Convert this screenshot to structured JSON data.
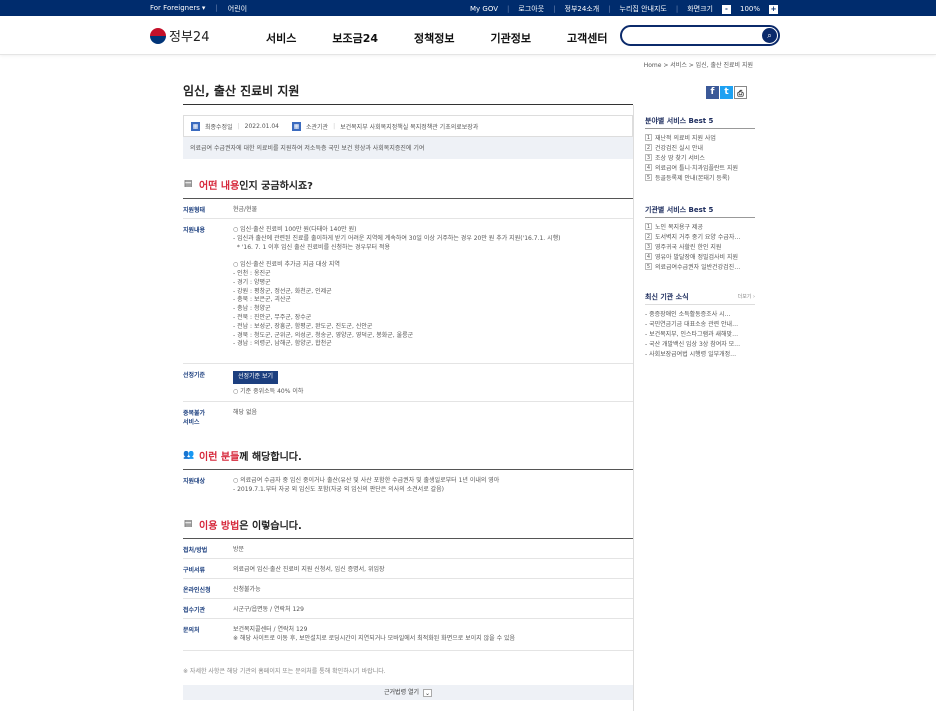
{
  "topbar": {
    "foreigners": "For Foreigners",
    "kids": "어린이",
    "mygov": "My GOV",
    "login": "로그아웃",
    "intro": "정부24소개",
    "sitemap": "누리집 안내지도",
    "screen": "화면크기",
    "zoom_out": "-",
    "zoom": "100%",
    "zoom_in": "+"
  },
  "header": {
    "logo": "정부24",
    "nav": [
      "서비스",
      "보조금24",
      "정책정보",
      "기관정보",
      "고객센터"
    ],
    "search_placeholder": "",
    "search_icon": "search-icon"
  },
  "breadcrumb": "Home  >  서비스  >  임신, 출산 진료비 지원",
  "page": {
    "title": "임신, 출산 진료비 지원",
    "share": {
      "facebook": "f",
      "twitter": "t",
      "print": "⎙"
    },
    "meta": {
      "date_label": "최종수정일",
      "date": "2022.01.04",
      "org_label": "소관기관",
      "org": "보건복지부 사회복지정책실 복지정책관 기초의료보장과"
    },
    "summary": "의료급여 수급권자에 대한 의료비를 지원하여 저소득층 국민 보건 향상과 사회복지증진에 기여",
    "sec1": {
      "hi": "어떤 내용",
      "rest": "인지 궁금하시죠?"
    },
    "form_label": "지원형태",
    "form_value": "현금/현물",
    "content_label": "지원내용",
    "content_value": "○ 임신·출산 진료비 100만 원(다태아 140만 원)\n- 임신과 출산에 관련된 진료를 출이하게 받기 어려운 지역에 계속하여 30일 이상 거주하는 경우 20만 원 추가 지원('16.7.1. 시행)\n  * '16. 7. 1 이후 임신 출산 진료비를 신청하는 경우부터 적용\n\n○ 임신·출산 진료비 추가금 지급 대상 지역\n- 인천 : 옹진군\n- 경기 : 양평군\n- 강원 : 평창군, 정선군, 화천군, 인제군\n- 충북 : 보은군, 괴산군\n- 충남 : 청양군\n- 전북 : 진안군, 무주군, 장수군\n- 전남 : 보성군, 장흥군, 함평군, 완도군, 진도군, 신안군\n- 경북 : 청도군, 군위군, 의성군, 청송군, 영양군, 영덕군, 봉화군, 울릉군\n- 경남 : 의령군, 남해군, 함양군, 합천군",
    "criteria_label": "선정기준",
    "criteria_button": "선정기준 보기",
    "criteria_value": "○ 기준 중위소득 40% 이하",
    "dup_label": "중복불가\n서비스",
    "dup_value": "해당 없음",
    "sec2": {
      "hi": "이런 분들",
      "rest": "께 해당합니다."
    },
    "target_label": "지원대상",
    "target_value": "○ 의료급여 수급자 중 임신 중이거나 출산(유산 및 사산 포함한 수급권자 및 출생일로부터 1년 이내의 영아\n- 2019.7.1.부터 자궁 외 임신도 포함(자궁 외 임신의 판단은 의사의 소견서로 갈음)",
    "sec3": {
      "hi": "이용 방법",
      "rest": "은 이렇습니다."
    },
    "method_label": "접처/방법",
    "method_value": "방문",
    "docs_label": "구비서류",
    "docs_value": "의료급여 임신·출산 진료비 지원 신청서, 임신 증명서, 위임장",
    "online_label": "온라인신청",
    "online_value": "신청불가능",
    "office_label": "접수기관",
    "office_value": "시군구/읍면동 / 연락처 129",
    "contact_label": "문의처",
    "contact_value": "보건복지콜센터 / 연락처 129\n※ 해당 사이트로 이동 후, 보안설치로 로딩시간이 지연되거나 모바일에서 최적화된 화면으로 보이지 않을 수 있음",
    "note": "※ 자세한 사항은 해당 기관의 홈페이지 또는 문의처를 통해 확인하시기 바랍니다.",
    "accordion": "근거법령 열기"
  },
  "side": {
    "b1": {
      "title": "분야별 서비스 Best 5",
      "items": [
        "재난적 의료비 지원 사업",
        "건강검진 실시 안내",
        "조상 땅 찾기 서비스",
        "의료급여 틀니·치과임플란트 지원",
        "등골등록제 안내(본태기 등록)"
      ]
    },
    "b2": {
      "title": "기관별 서비스 Best 5",
      "items": [
        "노인 복지용구 제공",
        "도서벽지 거주 중기 요양 수급자…",
        "영주귀국 사할린 한인 지원",
        "영유아 발달장애 정밀검사비 지원",
        "의료급여수급권자 일반건강검진…"
      ]
    },
    "b3": {
      "title": "최신 기관 소식",
      "more": "더보기 ›",
      "items": [
        "- 중증장애인 소득활동증조사 시…",
        "- 국민연금기금 대표소송 관련 안내…",
        "- 보건복지부, 인스타그램과 새해맞…",
        "- 국산 개발백신 임상 3상 참여자 모…",
        "- 사회보장급여법 시행령 일부개정…"
      ]
    }
  }
}
